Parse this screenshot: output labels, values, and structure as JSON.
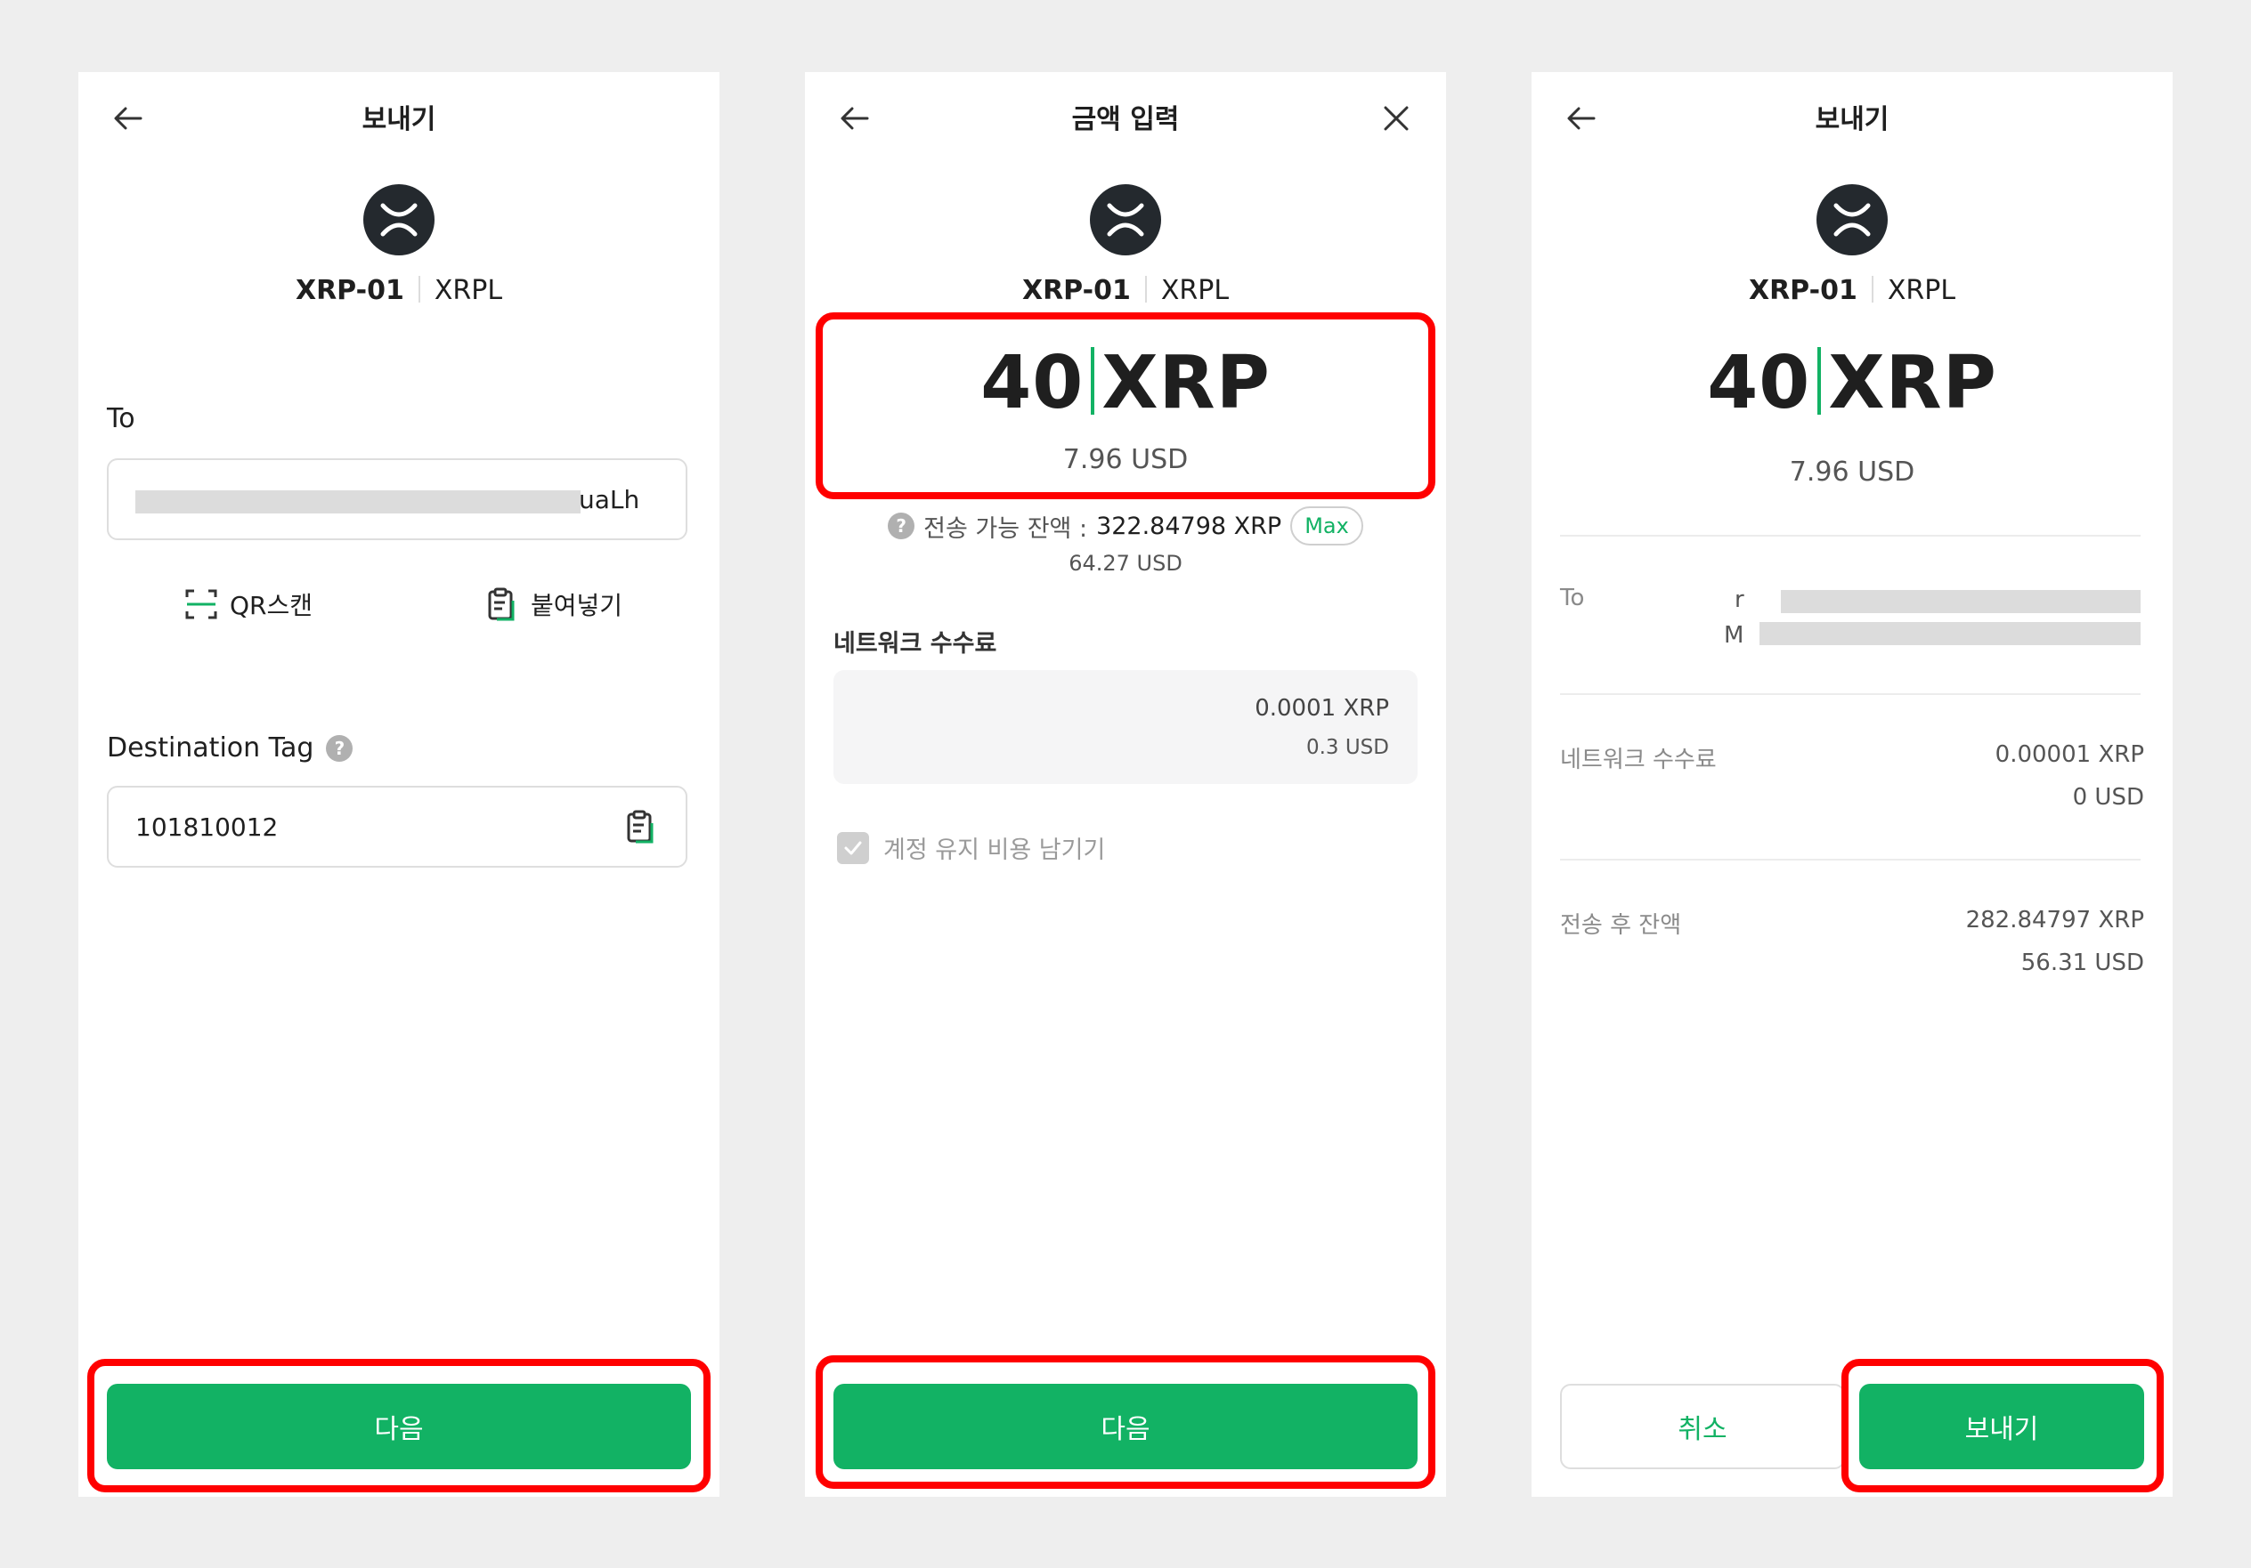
{
  "screen1": {
    "title": "보내기",
    "coin": {
      "name": "XRP-01",
      "network": "XRPL"
    },
    "to_label": "To",
    "address_tail": "uaLh",
    "qr_scan_label": "QR스캔",
    "paste_label": "붙여넣기",
    "destination_tag_label": "Destination Tag",
    "destination_tag_value": "101810012",
    "help_symbol": "?",
    "next_label": "다음"
  },
  "screen2": {
    "title": "금액 입력",
    "coin": {
      "name": "XRP-01",
      "network": "XRPL"
    },
    "amount_value": "40",
    "amount_unit": "XRP",
    "amount_usd": "7.96 USD",
    "help_symbol": "?",
    "available_label": "전송 가능 잔액 :",
    "available_value": "322.84798 XRP",
    "max_label": "Max",
    "available_usd": "64.27 USD",
    "network_fee_label": "네트워크 수수료",
    "fee_xrp": "0.0001 XRP",
    "fee_usd": "0.3 USD",
    "keep_reserve_label": "계정 유지 비용 남기기",
    "next_label": "다음"
  },
  "screen3": {
    "title": "보내기",
    "coin": {
      "name": "XRP-01",
      "network": "XRPL"
    },
    "amount_value": "40",
    "amount_unit": "XRP",
    "amount_usd": "7.96 USD",
    "to_label": "To",
    "address_line1_prefix": "r",
    "address_line2_prefix": "M",
    "network_fee_label": "네트워크 수수료",
    "fee_xrp": "0.00001 XRP",
    "fee_usd": "0 USD",
    "balance_after_label": "전송 후 잔액",
    "balance_after_xrp": "282.84797 XRP",
    "balance_after_usd": "56.31 USD",
    "cancel_label": "취소",
    "send_label": "보내기"
  },
  "colors": {
    "accent_green": "#12b264",
    "highlight_red": "#ff0000",
    "page_background": "#eeeeee",
    "panel_background": "#ffffff"
  },
  "icons": [
    "back-arrow-icon",
    "close-icon",
    "xrp-logo-icon",
    "qr-scan-icon",
    "paste-icon",
    "help-icon",
    "check-icon"
  ]
}
